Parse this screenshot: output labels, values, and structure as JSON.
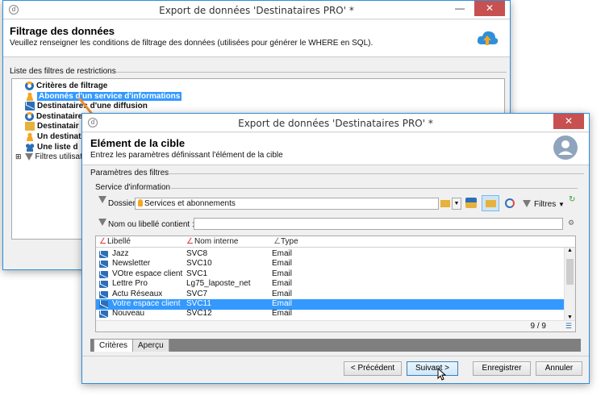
{
  "back_window": {
    "title": "Export de données 'Destinataires PRO' *",
    "header_title": "Filtrage des données",
    "header_subtitle": "Veuillez renseigner les conditions de filtrage des données (utilisées pour générer le WHERE en SQL).",
    "group_label": "Liste des filtres de restrictions",
    "tree": [
      {
        "label": "Critères de filtrage",
        "bold": true,
        "icon": "cycle-icon"
      },
      {
        "label": "Abonnés d'un service d'informations",
        "bold": true,
        "icon": "person-icon",
        "selected": true
      },
      {
        "label": "Destinataires d'une diffusion",
        "bold": true,
        "icon": "envelope-icon"
      },
      {
        "label": "Destinataires",
        "bold": true,
        "icon": "cycle-icon"
      },
      {
        "label": "Destinatair",
        "bold": true,
        "icon": "folder-icon"
      },
      {
        "label": "Un destinat",
        "bold": true,
        "icon": "person-icon"
      },
      {
        "label": "Une liste d",
        "bold": true,
        "icon": "people-icon"
      },
      {
        "label": "Filtres utilisat",
        "bold": false,
        "icon": "filter-icon",
        "expander": "⊞"
      }
    ]
  },
  "front_window": {
    "title": "Export de données 'Destinataires PRO' *",
    "header_title": "Elément de la cible",
    "header_subtitle": "Entrez les paramètres définissant l'élément de la cible",
    "params_label": "Paramètres des filtres",
    "service_label": "Service d'information",
    "folder_label": "Dossier :",
    "folder_value": "Services et abonnements",
    "filters_label": "Filtres",
    "name_label": "Nom ou libellé contient :",
    "name_value": "",
    "columns": [
      "Libellé",
      "Nom interne",
      "Type"
    ],
    "rows": [
      {
        "label": "Jazz",
        "internal": "SVC8",
        "type": "Email"
      },
      {
        "label": "Newsletter",
        "internal": "SVC10",
        "type": "Email"
      },
      {
        "label": "VOtre espace client",
        "internal": "SVC1",
        "type": "Email"
      },
      {
        "label": "Lettre Pro",
        "internal": "Lg75_laposte_net",
        "type": "Email"
      },
      {
        "label": "Actu Réseaux",
        "internal": "SVC7",
        "type": "Email"
      },
      {
        "label": "Votre espace client",
        "internal": "SVC11",
        "type": "Email",
        "selected": true
      },
      {
        "label": "Nouveau",
        "internal": "SVC12",
        "type": "Email"
      }
    ],
    "count": "9 / 9",
    "tabs": [
      "Critères",
      "Aperçu"
    ],
    "buttons": {
      "previous": "< Précédent",
      "next": "Suivant >",
      "save": "Enregistrer",
      "cancel": "Annuler"
    }
  },
  "colors": {
    "accent": "#3399ff",
    "close": "#c75050",
    "arrow": "#f08b2e",
    "envelope": "#2c6fb8"
  }
}
